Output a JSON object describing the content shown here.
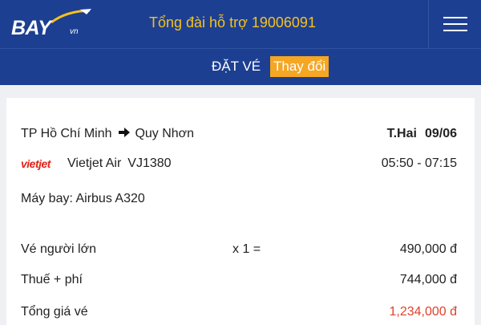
{
  "header": {
    "logo_text": "BAY",
    "logo_suffix": "vn",
    "hotline": "Tổng đài hỗ trợ 19006091",
    "menu_icon": "hamburger-menu-icon",
    "colors": {
      "bar": "#1d3f92",
      "hotline": "#f4c21c"
    }
  },
  "subbar": {
    "title": "ĐẶT VÉ",
    "change_label": "Thay đổi",
    "colors": {
      "change_bg": "#f5a623"
    }
  },
  "flight": {
    "origin": "TP Hồ Chí Minh",
    "destination": "Quy Nhơn",
    "arrow_icon": "arrow-right-icon",
    "day_of_week": "T.Hai",
    "date": "09/06",
    "airline_logo_text": "vietjet",
    "airline_name": "Vietjet Air",
    "flight_code": "VJ1380",
    "time_range": "05:50 - 07:15",
    "aircraft": "Máy bay: Airbus A320"
  },
  "pricing": {
    "adult_label": "Vé người lớn",
    "adult_qty": "x 1 =",
    "adult_price": "490,000 đ",
    "tax_label": "Thuế + phí",
    "tax_price": "744,000 đ",
    "total_label": "Tổng giá vé",
    "total_price": "1,234,000 đ",
    "colors": {
      "total": "#e0412a"
    }
  }
}
